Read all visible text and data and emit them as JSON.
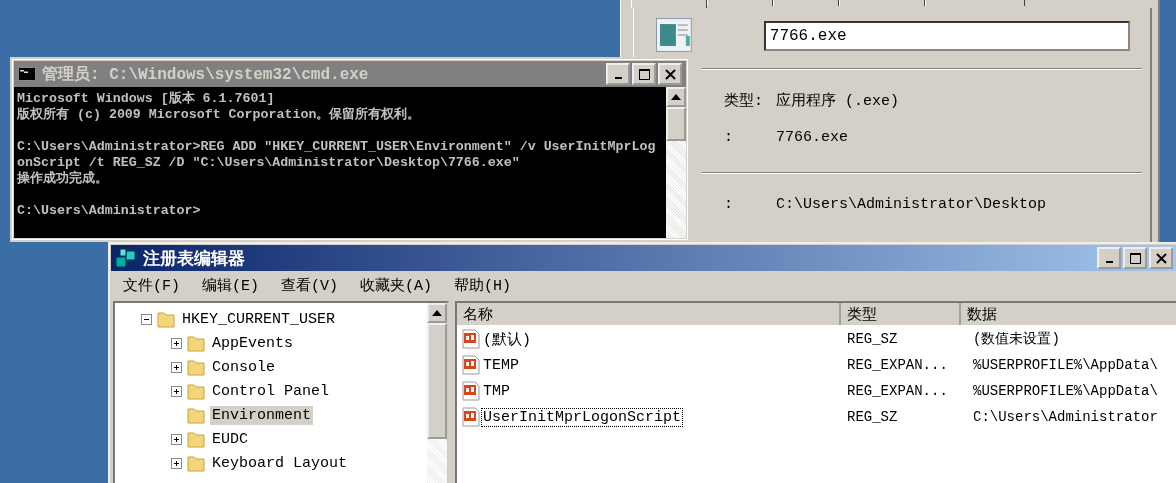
{
  "properties_window": {
    "file_name": "7766.exe",
    "fields": [
      {
        "label": "类型:",
        "value": "应用程序 (.exe)",
        "divider_after": false
      },
      {
        "label": ":",
        "value": "7766.exe",
        "divider_after": true
      },
      {
        "label": ":",
        "value": "C:\\Users\\Administrator\\Desktop",
        "divider_after": false
      }
    ]
  },
  "cmd_window": {
    "title": "管理员: C:\\Windows\\system32\\cmd.exe",
    "lines": [
      {
        "text": "Microsoft Windows [版本 6.1.7601]",
        "blank_after": false
      },
      {
        "text": "版权所有 (c) 2009 Microsoft Corporation。保留所有权利。",
        "blank_after": true
      },
      {
        "text": "C:\\Users\\Administrator>REG ADD \"HKEY_CURRENT_USER\\Environment\" /v UserInitMprLog",
        "blank_after": false
      },
      {
        "text": "onScript /t REG_SZ /D \"C:\\Users\\Administrator\\Desktop\\7766.exe\"",
        "blank_after": false
      },
      {
        "text": "操作成功完成。",
        "blank_after": true
      },
      {
        "text": "C:\\Users\\Administrator>",
        "blank_after": false
      }
    ]
  },
  "regedit_window": {
    "title": "注册表编辑器",
    "menu": [
      "文件(F)",
      "编辑(E)",
      "查看(V)",
      "收藏夹(A)",
      "帮助(H)"
    ],
    "tree": {
      "label": "HKEY_CURRENT_USER",
      "expanded": true,
      "selected": false,
      "children": [
        {
          "label": "AppEvents",
          "expandable": true,
          "selected": false
        },
        {
          "label": "Console",
          "expandable": true,
          "selected": false
        },
        {
          "label": "Control Panel",
          "expandable": true,
          "selected": false
        },
        {
          "label": "Environment",
          "expandable": false,
          "selected": true
        },
        {
          "label": "EUDC",
          "expandable": true,
          "selected": false
        },
        {
          "label": "Keyboard Layout",
          "expandable": true,
          "selected": false
        }
      ]
    },
    "columns": [
      "名称",
      "类型",
      "数据"
    ],
    "rows": [
      {
        "name": "(默认)",
        "type": "REG_SZ",
        "data": "(数值未设置)",
        "focused": false
      },
      {
        "name": "TEMP",
        "type": "REG_EXPAN...",
        "data": "%USERPROFILE%\\AppData\\",
        "focused": false
      },
      {
        "name": "TMP",
        "type": "REG_EXPAN...",
        "data": "%USERPROFILE%\\AppData\\",
        "focused": false
      },
      {
        "name": "UserInitMprLogonScript",
        "type": "REG_SZ",
        "data": "C:\\Users\\Administrator",
        "focused": true
      }
    ]
  }
}
